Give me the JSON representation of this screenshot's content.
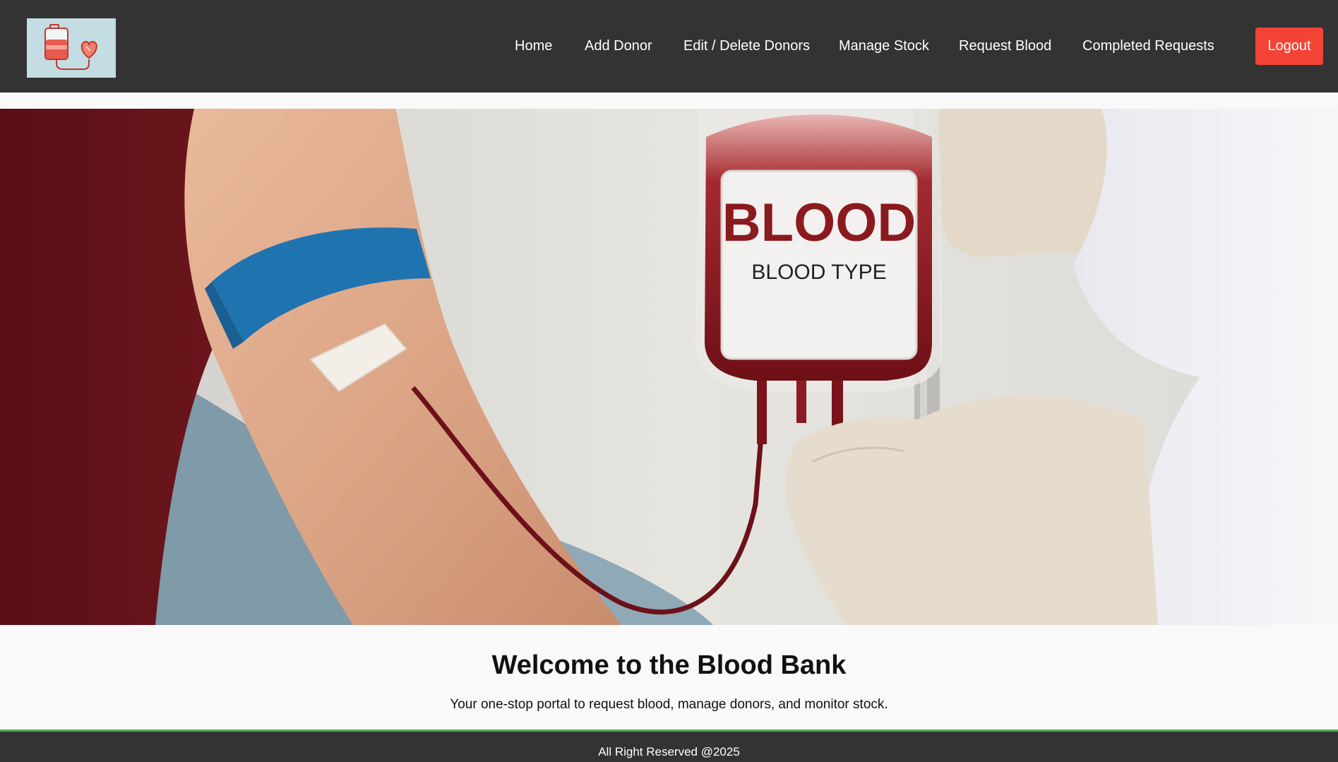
{
  "nav": {
    "logo_alt": "Blood Bank logo",
    "links": [
      "Home",
      "Add Donor",
      "Edit / Delete Donors",
      "Manage Stock",
      "Request Blood",
      "Completed Requests"
    ],
    "logout_label": "Logout"
  },
  "hero": {
    "bag_label_title": "BLOOD",
    "bag_label_subtitle": "BLOOD TYPE"
  },
  "main": {
    "heading": "Welcome to the Blood Bank",
    "tagline": "Your one-stop portal to request blood, manage donors, and monitor stock."
  },
  "footer": {
    "text": "All Right Reserved @2025"
  },
  "colors": {
    "navbar_bg": "#333333",
    "logout_bg": "#f44336",
    "footer_border": "#4caf50",
    "page_bg": "#f9f9f9"
  }
}
